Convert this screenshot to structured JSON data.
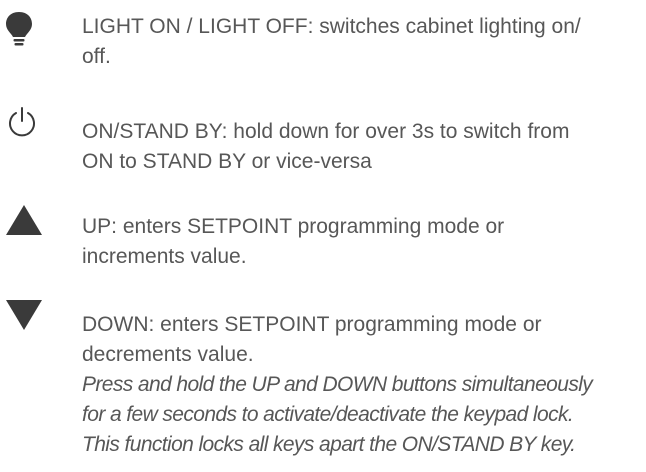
{
  "colors": {
    "text": "#575757",
    "icon": "#3a3a3a"
  },
  "items": [
    {
      "icon": "lightbulb-icon",
      "lines": [
        "LIGHT ON / LIGHT OFF: switches cabinet lighting on/",
        "off."
      ]
    },
    {
      "icon": "power-icon",
      "lines": [
        "ON/STAND BY: hold down for over 3s to switch from",
        "ON to STAND BY or vice-versa"
      ]
    },
    {
      "icon": "up-arrow-icon",
      "words": [
        "UP:",
        "enters",
        "SETPOINT",
        "programming",
        "mode",
        "or"
      ],
      "lines": [
        "increments value."
      ]
    },
    {
      "icon": "down-arrow-icon",
      "words": [
        "DOWN:",
        "enters",
        "SETPOINT",
        "programming",
        "mode",
        "or"
      ],
      "lines": [
        "decrements value."
      ],
      "note_lines": [
        "Press and hold the UP and DOWN buttons simultaneously",
        "for a few seconds to activate/deactivate the keypad lock.",
        "This function locks all keys apart the ON/STAND BY key."
      ]
    }
  ]
}
